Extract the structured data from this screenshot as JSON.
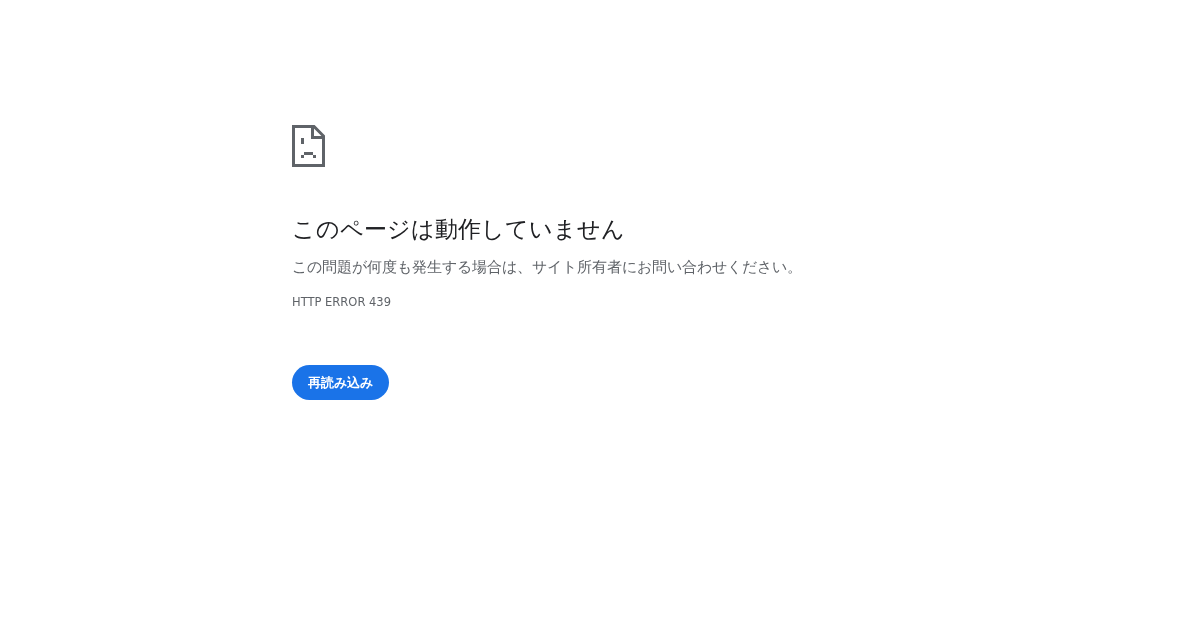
{
  "heading": "このページは動作していません",
  "message": "この問題が何度も発生する場合は、サイト所有者にお問い合わせください。",
  "error_code": "HTTP ERROR 439",
  "reload_button": "再読み込み"
}
